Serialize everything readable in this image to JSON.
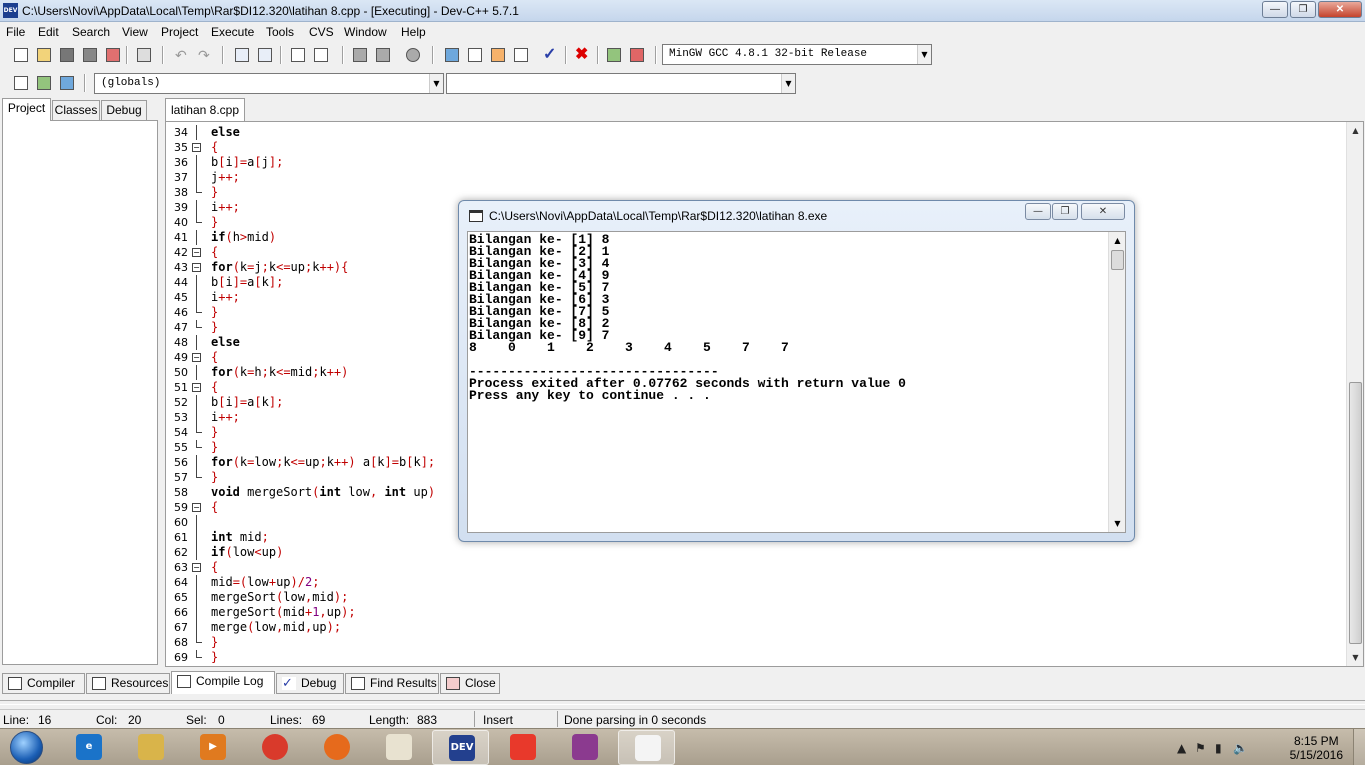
{
  "window": {
    "title": "C:\\Users\\Novi\\AppData\\Local\\Temp\\Rar$DI12.320\\latihan 8.cpp - [Executing] - Dev-C++ 5.7.1",
    "icon_text": "DEV"
  },
  "menu": [
    "File",
    "Edit",
    "Search",
    "View",
    "Project",
    "Execute",
    "Tools",
    "CVS",
    "Window",
    "Help"
  ],
  "toolbar": {
    "compiler_select": "MinGW GCC 4.8.1 32-bit Release",
    "scope_select": "(globals)",
    "member_select": ""
  },
  "left_panel": {
    "tabs": [
      "Project",
      "Classes",
      "Debug"
    ]
  },
  "editor": {
    "tab": "latihan 8.cpp",
    "lines": [
      {
        "n": "34",
        "fold": "line",
        "t": "<span class=\"kw\">else</span>"
      },
      {
        "n": "35",
        "fold": "box",
        "t": "<span class=\"sym\">{</span>"
      },
      {
        "n": "36",
        "fold": "line",
        "t": "b<span class=\"sym\">[</span>i<span class=\"sym\">]=</span>a<span class=\"sym\">[</span>j<span class=\"sym\">];</span>"
      },
      {
        "n": "37",
        "fold": "line",
        "t": "j<span class=\"sym\">++;</span>"
      },
      {
        "n": "38",
        "fold": "end",
        "t": "<span class=\"sym\">}</span>"
      },
      {
        "n": "39",
        "fold": "line",
        "t": "i<span class=\"sym\">++;</span>"
      },
      {
        "n": "40",
        "fold": "end",
        "t": "<span class=\"sym\">}</span>"
      },
      {
        "n": "41",
        "fold": "line",
        "t": "<span class=\"kw\">if</span><span class=\"sym\">(</span>h<span class=\"sym\">&gt;</span>mid<span class=\"sym\">)</span>"
      },
      {
        "n": "42",
        "fold": "box",
        "t": "<span class=\"sym\">{</span>"
      },
      {
        "n": "43",
        "fold": "box",
        "t": "<span class=\"kw\">for</span><span class=\"sym\">(</span>k<span class=\"sym\">=</span>j<span class=\"sym\">;</span>k<span class=\"sym\">&lt;=</span>up<span class=\"sym\">;</span>k<span class=\"sym\">++){</span>"
      },
      {
        "n": "44",
        "fold": "line",
        "t": "b<span class=\"sym\">[</span>i<span class=\"sym\">]=</span>a<span class=\"sym\">[</span>k<span class=\"sym\">];</span>"
      },
      {
        "n": "45",
        "fold": "line",
        "t": "i<span class=\"sym\">++;</span>"
      },
      {
        "n": "46",
        "fold": "end",
        "t": "<span class=\"sym\">}</span>"
      },
      {
        "n": "47",
        "fold": "end",
        "t": "<span class=\"sym\">}</span>"
      },
      {
        "n": "48",
        "fold": "line",
        "t": "<span class=\"kw\">else</span>"
      },
      {
        "n": "49",
        "fold": "box",
        "t": "<span class=\"sym\">{</span>"
      },
      {
        "n": "50",
        "fold": "line",
        "t": "<span class=\"kw\">for</span><span class=\"sym\">(</span>k<span class=\"sym\">=</span>h<span class=\"sym\">;</span>k<span class=\"sym\">&lt;=</span>mid<span class=\"sym\">;</span>k<span class=\"sym\">++)</span>"
      },
      {
        "n": "51",
        "fold": "box",
        "t": "<span class=\"sym\">{</span>"
      },
      {
        "n": "52",
        "fold": "line",
        "t": "b<span class=\"sym\">[</span>i<span class=\"sym\">]=</span>a<span class=\"sym\">[</span>k<span class=\"sym\">];</span>"
      },
      {
        "n": "53",
        "fold": "line",
        "t": "i<span class=\"sym\">++;</span>"
      },
      {
        "n": "54",
        "fold": "end",
        "t": "<span class=\"sym\">}</span>"
      },
      {
        "n": "55",
        "fold": "end",
        "t": "<span class=\"sym\">}</span>"
      },
      {
        "n": "56",
        "fold": "line",
        "t": "<span class=\"kw\">for</span><span class=\"sym\">(</span>k<span class=\"sym\">=</span>low<span class=\"sym\">;</span>k<span class=\"sym\">&lt;=</span>up<span class=\"sym\">;</span>k<span class=\"sym\">++)</span> a<span class=\"sym\">[</span>k<span class=\"sym\">]=</span>b<span class=\"sym\">[</span>k<span class=\"sym\">];</span>"
      },
      {
        "n": "57",
        "fold": "end",
        "t": "<span class=\"sym\">}</span>"
      },
      {
        "n": "58",
        "fold": "none",
        "t": "<span class=\"kw\">void</span> mergeSort<span class=\"sym\">(</span><span class=\"kw\">int</span> low<span class=\"sym\">,</span> <span class=\"kw\">int</span> up<span class=\"sym\">)</span>"
      },
      {
        "n": "59",
        "fold": "box",
        "t": "<span class=\"sym\">{</span>"
      },
      {
        "n": "60",
        "fold": "line",
        "t": ""
      },
      {
        "n": "61",
        "fold": "line",
        "t": "<span class=\"kw\">int</span> mid<span class=\"sym\">;</span>"
      },
      {
        "n": "62",
        "fold": "line",
        "t": "<span class=\"kw\">if</span><span class=\"sym\">(</span>low<span class=\"sym\">&lt;</span>up<span class=\"sym\">)</span>"
      },
      {
        "n": "63",
        "fold": "box",
        "t": "<span class=\"sym\">{</span>"
      },
      {
        "n": "64",
        "fold": "line",
        "t": "mid<span class=\"sym\">=(</span>low<span class=\"sym\">+</span>up<span class=\"sym\">)/</span><span class=\"num\">2</span><span class=\"sym\">;</span>"
      },
      {
        "n": "65",
        "fold": "line",
        "t": "mergeSort<span class=\"sym\">(</span>low<span class=\"sym\">,</span>mid<span class=\"sym\">);</span>"
      },
      {
        "n": "66",
        "fold": "line",
        "t": "mergeSort<span class=\"sym\">(</span>mid<span class=\"sym\">+</span><span class=\"num\">1</span><span class=\"sym\">,</span>up<span class=\"sym\">);</span>"
      },
      {
        "n": "67",
        "fold": "line",
        "t": "merge<span class=\"sym\">(</span>low<span class=\"sym\">,</span>mid<span class=\"sym\">,</span>up<span class=\"sym\">);</span>"
      },
      {
        "n": "68",
        "fold": "end",
        "t": "<span class=\"sym\">}</span>"
      },
      {
        "n": "69",
        "fold": "end",
        "t": "<span class=\"sym\">}</span>"
      }
    ]
  },
  "console": {
    "title": "C:\\Users\\Novi\\AppData\\Local\\Temp\\Rar$DI12.320\\latihan 8.exe",
    "output": "Bilangan ke- [1] 8\nBilangan ke- [2] 1\nBilangan ke- [3] 4\nBilangan ke- [4] 9\nBilangan ke- [5] 7\nBilangan ke- [6] 3\nBilangan ke- [7] 5\nBilangan ke- [8] 2\nBilangan ke- [9] 7\n8    0    1    2    3    4    5    7    7\n\n--------------------------------\nProcess exited after 0.07762 seconds with return value 0\nPress any key to continue . . ."
  },
  "bottom_tabs": [
    "Compiler",
    "Resources",
    "Compile Log",
    "Debug",
    "Find Results",
    "Close"
  ],
  "status": {
    "line_label": "Line:",
    "line": "16",
    "col_label": "Col:",
    "col": "20",
    "sel_label": "Sel:",
    "sel": "0",
    "lines_label": "Lines:",
    "lines": "69",
    "length_label": "Length:",
    "length": "883",
    "mode": "Insert",
    "message": "Done parsing in 0 seconds"
  },
  "taskbar": {
    "apps": [
      {
        "name": "internet-explorer",
        "label": "e",
        "color": "#1a73c9"
      },
      {
        "name": "file-explorer",
        "label": "",
        "color": "#d9b44a"
      },
      {
        "name": "media-player",
        "label": "▶",
        "color": "#e07a1f"
      },
      {
        "name": "chrome",
        "label": "",
        "color": "#d93a2b"
      },
      {
        "name": "firefox",
        "label": "",
        "color": "#e66a1c"
      },
      {
        "name": "game",
        "label": "",
        "color": "#e8e2d0"
      },
      {
        "name": "dev-cpp",
        "label": "DEV",
        "color": "#23408e"
      },
      {
        "name": "camera-app",
        "label": "",
        "color": "#e8392b"
      },
      {
        "name": "winrar",
        "label": "",
        "color": "#8b3a8f"
      },
      {
        "name": "console-app",
        "label": "",
        "color": "#f4f4f4"
      }
    ],
    "time": "8:15 PM",
    "date": "5/15/2016"
  }
}
